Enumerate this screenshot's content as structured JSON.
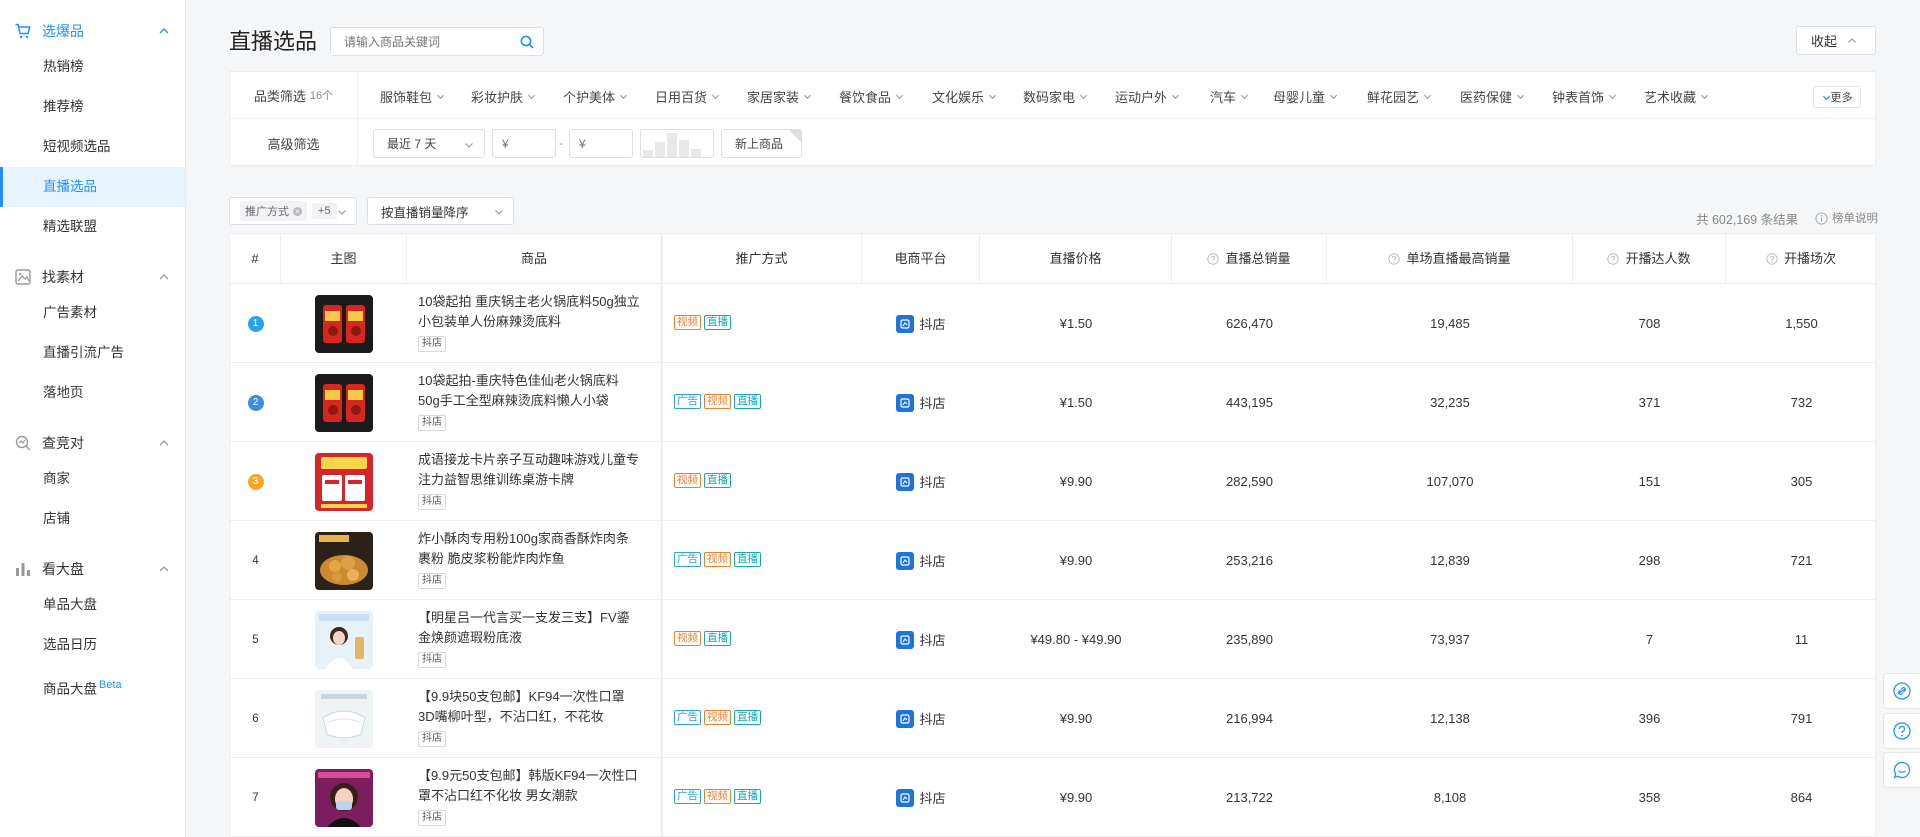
{
  "sidebar": {
    "groups": [
      {
        "label": "选爆品",
        "icon": "cart-icon",
        "active": true,
        "items": [
          "热销榜",
          "推荐榜",
          "短视频选品",
          "直播选品",
          "精选联盟"
        ],
        "active_item": 3
      },
      {
        "label": "找素材",
        "icon": "material-icon",
        "active": false,
        "items": [
          "广告素材",
          "直播引流广告",
          "落地页"
        ]
      },
      {
        "label": "查竞对",
        "icon": "compete-icon",
        "active": false,
        "items": [
          "商家",
          "店铺"
        ]
      },
      {
        "label": "看大盘",
        "icon": "bar-chart-icon",
        "active": false,
        "items": [
          "单品大盘",
          "选品日历",
          "商品大盘"
        ],
        "beta": "Beta"
      }
    ]
  },
  "header": {
    "title": "直播选品",
    "search_placeholder": "请输入商品关键词",
    "collapse_label": "收起"
  },
  "filters": {
    "category_label": "品类筛选",
    "category_count": "16个",
    "categories": [
      "服饰鞋包",
      "彩妆护肤",
      "个护美体",
      "日用百货",
      "家居家装",
      "餐饮食品",
      "文化娱乐",
      "数码家电",
      "运动户外",
      "汽车",
      "母婴儿童",
      "鲜花园艺",
      "医药保健",
      "钟表首饰",
      "艺术收藏"
    ],
    "more_label": "更多",
    "advanced_label": "高级筛选",
    "date_range": "最近 7 天",
    "price_min_placeholder": "¥",
    "price_max_placeholder": "¥",
    "price_sep": "-",
    "new_label": "新上商品"
  },
  "toolbar": {
    "promo_chip": "推广方式",
    "promo_more": "+5",
    "sort_label": "按直播销量降序",
    "result_count": "共 602,169 条结果",
    "rules_label": "榜单说明"
  },
  "table": {
    "headers": [
      "#",
      "主图",
      "商品",
      "推广方式",
      "电商平台",
      "直播价格",
      "直播总销量",
      "单场直播最高销量",
      "开播达人数",
      "开播场次"
    ],
    "rows": [
      {
        "rank": "1",
        "name": "10袋起拍 重庆锅主老火锅底料50g独立小包装单人份麻辣烫底料",
        "shop": "抖店",
        "tags": [
          "video",
          "live"
        ],
        "platform": "抖店",
        "price": "¥1.50",
        "total_sales": "626,470",
        "max_sales": "19,485",
        "anchors": "708",
        "sessions": "1,550",
        "thumb": "hotpot"
      },
      {
        "rank": "2",
        "name": "10袋起拍-重庆特色佳仙老火锅底料50g手工全型麻辣烫底料懒人小袋",
        "shop": "抖店",
        "tags": [
          "ad",
          "video",
          "live"
        ],
        "platform": "抖店",
        "price": "¥1.50",
        "total_sales": "443,195",
        "max_sales": "32,235",
        "anchors": "371",
        "sessions": "732",
        "thumb": "hotpot"
      },
      {
        "rank": "3",
        "name": "成语接龙卡片亲子互动趣味游戏儿童专注力益智思维训练桌游卡牌",
        "shop": "抖店",
        "tags": [
          "video",
          "live"
        ],
        "platform": "抖店",
        "price": "¥9.90",
        "total_sales": "282,590",
        "max_sales": "107,070",
        "anchors": "151",
        "sessions": "305",
        "thumb": "cards"
      },
      {
        "rank": "4",
        "name": "炸小酥肉专用粉100g家商香酥炸肉条 裹粉 脆皮浆粉能炸肉炸鱼",
        "shop": "抖店",
        "tags": [
          "ad",
          "video",
          "live"
        ],
        "platform": "抖店",
        "price": "¥9.90",
        "total_sales": "253,216",
        "max_sales": "12,839",
        "anchors": "298",
        "sessions": "721",
        "thumb": "fried"
      },
      {
        "rank": "5",
        "name": "【明星吕一代言买一支发三支】FV鎏金焕颜遮瑕粉底液",
        "shop": "抖店",
        "tags": [
          "video",
          "live"
        ],
        "platform": "抖店",
        "price": "¥49.80 - ¥49.90",
        "total_sales": "235,890",
        "max_sales": "73,937",
        "anchors": "7",
        "sessions": "11",
        "thumb": "star"
      },
      {
        "rank": "6",
        "name": "【9.9块50支包邮】KF94一次性口罩3D嘴柳叶型，不沾口红，不花妆",
        "shop": "抖店",
        "tags": [
          "ad",
          "video",
          "live"
        ],
        "platform": "抖店",
        "price": "¥9.90",
        "total_sales": "216,994",
        "max_sales": "12,138",
        "anchors": "396",
        "sessions": "791",
        "thumb": "mask"
      },
      {
        "rank": "7",
        "name": "【9.9元50支包邮】韩版KF94一次性口罩不沾口红不化妆 男女潮款",
        "shop": "抖店",
        "tags": [
          "ad",
          "video",
          "live"
        ],
        "platform": "抖店",
        "price": "¥9.90",
        "total_sales": "213,722",
        "max_sales": "8,108",
        "anchors": "358",
        "sessions": "864",
        "thumb": "girl"
      }
    ],
    "tag_labels": {
      "ad": "广告",
      "video": "视频",
      "live": "直播"
    }
  },
  "colors": {
    "accent": "#1e90ff",
    "rank1": "#29a3e6",
    "rank2": "#3a8ee6",
    "rank3": "#f5a623"
  }
}
